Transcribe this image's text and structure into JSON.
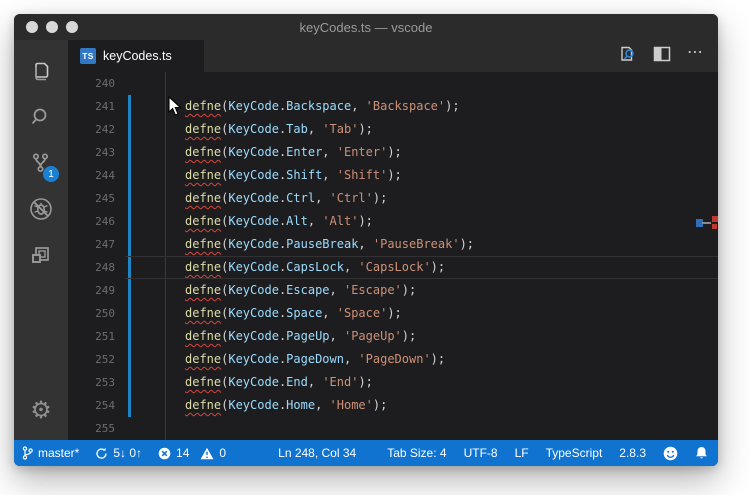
{
  "window": {
    "title": "keyCodes.ts — vscode"
  },
  "traffic_lights": [
    "close",
    "minimize",
    "zoom"
  ],
  "activity_bar": {
    "items": [
      {
        "name": "explorer",
        "icon": "files-icon"
      },
      {
        "name": "search",
        "icon": "search-icon"
      },
      {
        "name": "source-control",
        "icon": "git-branch-icon",
        "badge": "1"
      },
      {
        "name": "debug-disabled",
        "icon": "bug-slash-icon"
      },
      {
        "name": "extensions",
        "icon": "extensions-icon"
      }
    ],
    "scm_badge": "1",
    "gear_glyph": "⚙"
  },
  "tab_bar": {
    "active_tab": {
      "label": "keyCodes.ts",
      "file_badge": "TS"
    },
    "actions": [
      {
        "name": "open-preview",
        "icon": "file-search-icon"
      },
      {
        "name": "split-editor",
        "icon": "split-editor-icon"
      },
      {
        "name": "more-actions",
        "icon": "ellipsis-icon",
        "glyph": "⋯"
      }
    ]
  },
  "editor": {
    "syntax": {
      "fn": "defne",
      "object": "KeyCode",
      "open": "(",
      "dot": ".",
      "comma": ", ",
      "close": ");"
    },
    "current_line": 248,
    "modified_range": {
      "from": 241,
      "to": 254
    },
    "lines": [
      {
        "number": "240"
      },
      {
        "number": "241",
        "member": "Backspace",
        "string": "'Backspace'"
      },
      {
        "number": "242",
        "member": "Tab",
        "string": "'Tab'"
      },
      {
        "number": "243",
        "member": "Enter",
        "string": "'Enter'"
      },
      {
        "number": "244",
        "member": "Shift",
        "string": "'Shift'"
      },
      {
        "number": "245",
        "member": "Ctrl",
        "string": "'Ctrl'"
      },
      {
        "number": "246",
        "member": "Alt",
        "string": "'Alt'"
      },
      {
        "number": "247",
        "member": "PauseBreak",
        "string": "'PauseBreak'"
      },
      {
        "number": "248",
        "member": "CapsLock",
        "string": "'CapsLock'"
      },
      {
        "number": "249",
        "member": "Escape",
        "string": "'Escape'"
      },
      {
        "number": "250",
        "member": "Space",
        "string": "'Space'"
      },
      {
        "number": "251",
        "member": "PageUp",
        "string": "'PageUp'"
      },
      {
        "number": "252",
        "member": "PageDown",
        "string": "'PageDown'"
      },
      {
        "number": "253",
        "member": "End",
        "string": "'End'"
      },
      {
        "number": "254",
        "member": "Home",
        "string": "'Home'"
      },
      {
        "number": "255"
      }
    ]
  },
  "status_bar": {
    "branch": "master*",
    "sync": "5↓ 0↑",
    "errors": "14",
    "warnings": "0",
    "cursor_position": "Ln 248, Col 34",
    "tab_size": "Tab Size: 4",
    "encoding": "UTF-8",
    "eol": "LF",
    "language": "TypeScript",
    "version": "2.8.3"
  },
  "colors": {
    "status_bar": "#1073cf",
    "modified_gutter": "#1f86c6",
    "function_token": "#dcdcaa",
    "identifier_token": "#9cdcfe",
    "string_token": "#ce9178",
    "error_squiggle": "#d8453a",
    "ts_badge": "#3179c7"
  }
}
